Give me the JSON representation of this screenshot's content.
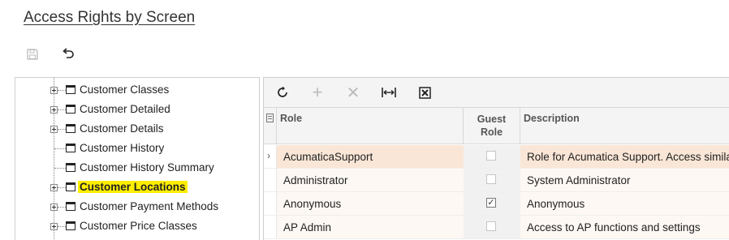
{
  "page": {
    "title": "Access Rights by Screen"
  },
  "toolbar": {
    "save_icon": "save-icon",
    "undo_icon": "undo-icon"
  },
  "tree": {
    "items": [
      {
        "label": "Customer Classes",
        "expandable": true,
        "selected": false
      },
      {
        "label": "Customer Detailed",
        "expandable": true,
        "selected": false
      },
      {
        "label": "Customer Details",
        "expandable": true,
        "selected": false
      },
      {
        "label": "Customer History",
        "expandable": false,
        "selected": false
      },
      {
        "label": "Customer History Summary",
        "expandable": false,
        "selected": false
      },
      {
        "label": "Customer Locations",
        "expandable": true,
        "selected": true
      },
      {
        "label": "Customer Payment Methods",
        "expandable": true,
        "selected": false
      },
      {
        "label": "Customer Price Classes",
        "expandable": true,
        "selected": false
      }
    ]
  },
  "grid": {
    "toolbar": [
      "refresh-icon",
      "add-icon",
      "delete-icon",
      "fit-columns-icon",
      "export-excel-icon"
    ],
    "columns": {
      "role": "Role",
      "guest_role": "Guest\nRole",
      "description": "Description"
    },
    "rows": [
      {
        "role": "AcumaticaSupport",
        "guest_role": false,
        "description": "Role for Acumatica Support. Access similar",
        "active": true
      },
      {
        "role": "Administrator",
        "guest_role": false,
        "description": "System Administrator",
        "active": false
      },
      {
        "role": "Anonymous",
        "guest_role": true,
        "description": "Anonymous",
        "active": false
      },
      {
        "role": "AP Admin",
        "guest_role": false,
        "description": "Access to AP functions and settings",
        "active": false
      }
    ]
  },
  "colors": {
    "highlight": "#ffee00",
    "active_row": "#fae6d6",
    "row_bg": "#fdf8f3"
  }
}
